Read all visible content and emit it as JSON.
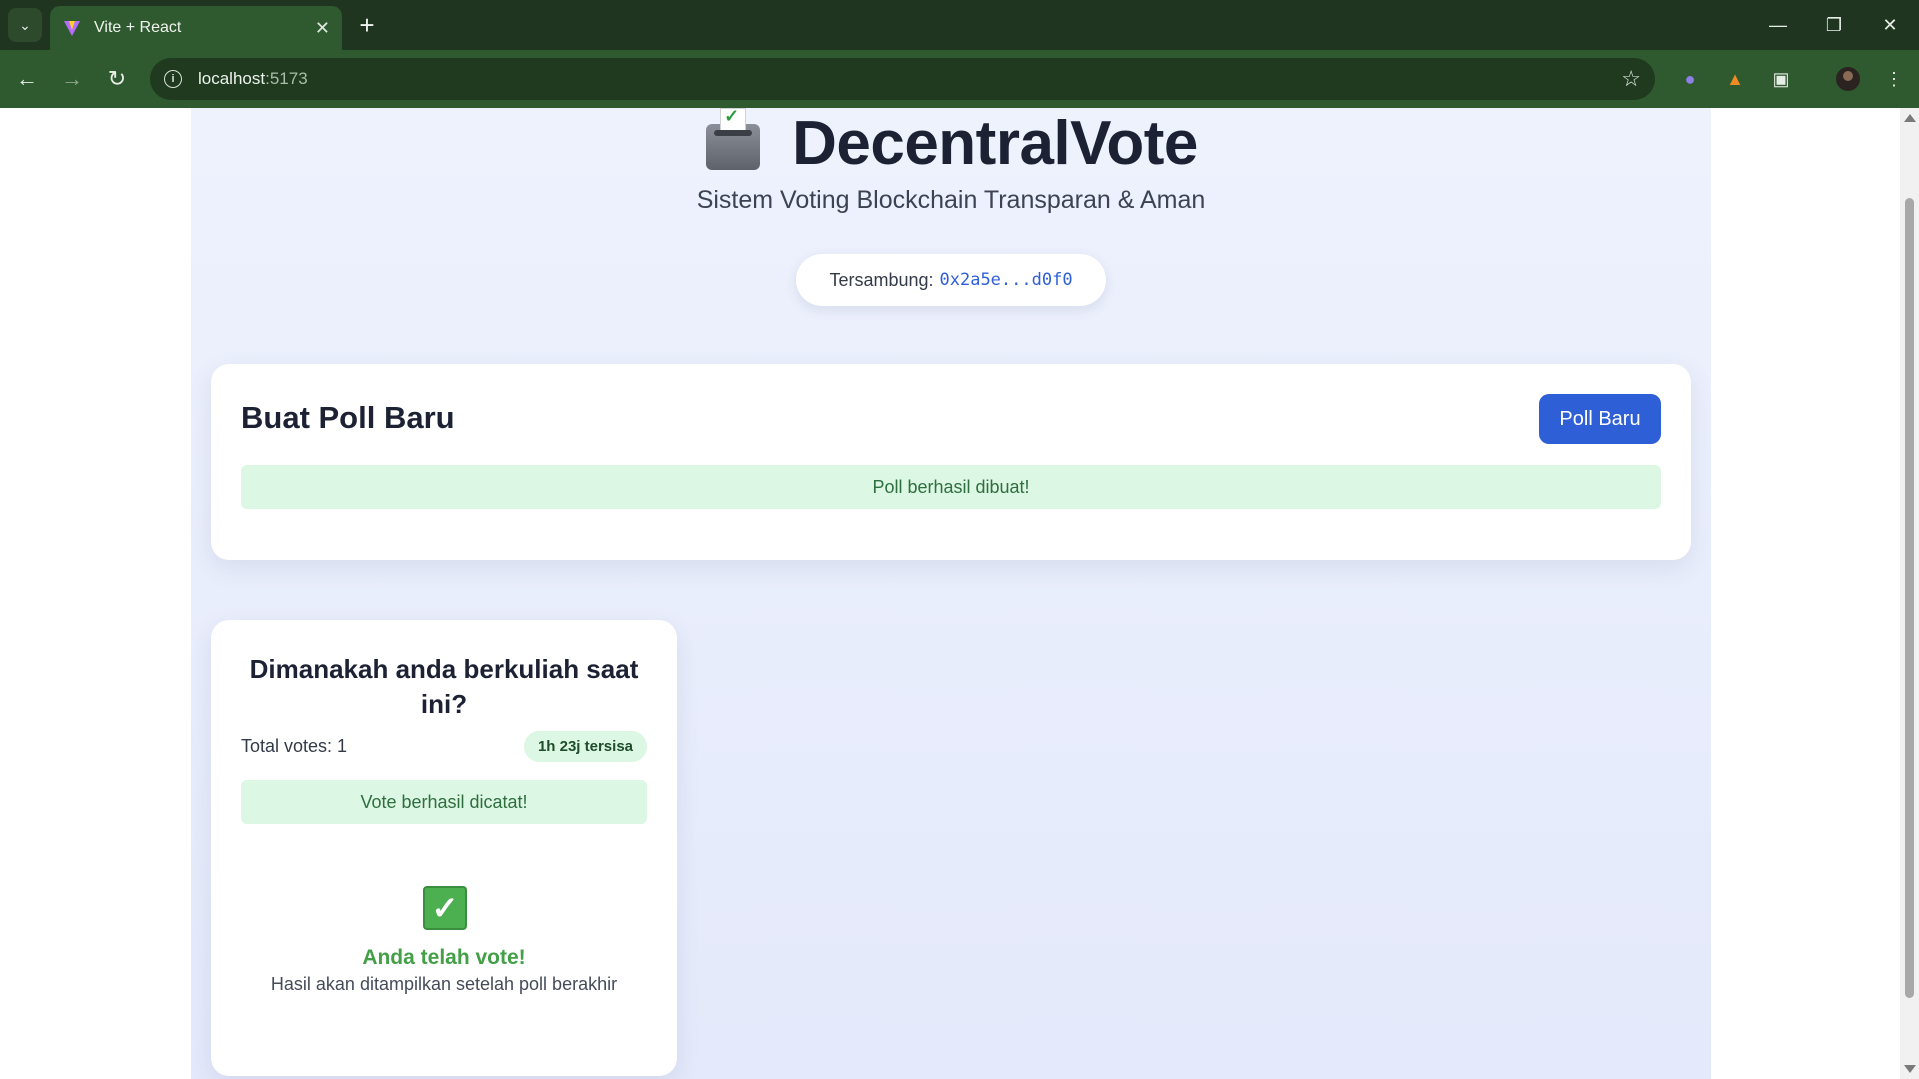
{
  "browser": {
    "tab_title": "Vite + React",
    "url_host": "localhost",
    "url_port": ":5173"
  },
  "header": {
    "title": "DecentralVote",
    "subtitle": "Sistem Voting Blockchain Transparan & Aman",
    "wallet_label": "Tersambung:",
    "wallet_address": "0x2a5e...d0f0"
  },
  "create_poll": {
    "title": "Buat Poll Baru",
    "new_button": "Poll Baru",
    "success_message": "Poll berhasil dibuat!"
  },
  "polls": [
    {
      "question": "Dimanakah anda berkuliah saat ini?",
      "total_votes": "Total votes: 1",
      "time_left": "1h 23j tersisa",
      "vote_message": "Vote berhasil dicatat!",
      "voted_title": "Anda telah vote!",
      "voted_note": "Hasil akan ditampilkan setelah poll berakhir"
    }
  ],
  "colors": {
    "primary": "#2f5fd6",
    "success_bg": "#dcf7e3",
    "success_text": "#43a047",
    "browser_frame": "#2f5a2f"
  },
  "icons": {
    "tab_favicon": "vite-logo-icon",
    "logo": "ballot-box-icon",
    "voted": "check-box-icon"
  }
}
